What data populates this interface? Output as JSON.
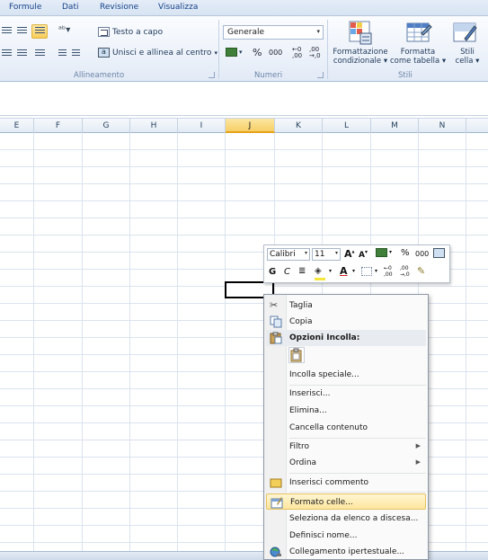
{
  "tabs": [
    "Formule",
    "Dati",
    "Revisione",
    "Visualizza"
  ],
  "ribbon": {
    "alignment": {
      "wrap_text": "Testo a capo",
      "merge_center": "Unisci e allinea al centro",
      "group_label": "Allineamento"
    },
    "number": {
      "format_value": "Generale",
      "percent": "%",
      "thousands": "000",
      "group_label": "Numeri"
    },
    "styles": {
      "conditional_1": "Formattazione",
      "conditional_2": "condizionale",
      "table_1": "Formatta",
      "table_2": "come tabella",
      "cell_1": "Stili",
      "cell_2": "cella",
      "group_label": "Stili"
    }
  },
  "columns": [
    "E",
    "F",
    "G",
    "H",
    "I",
    "J",
    "K",
    "L",
    "M",
    "N"
  ],
  "selected_column": "J",
  "mini_toolbar": {
    "font": "Calibri",
    "size": "11",
    "bold": "G",
    "italic": "C",
    "percent": "%",
    "thousands": "000"
  },
  "context_menu": {
    "cut": "Taglia",
    "copy": "Copia",
    "paste_options": "Opzioni Incolla:",
    "paste_special": "Incolla speciale...",
    "insert": "Inserisci...",
    "delete": "Elimina...",
    "clear_contents": "Cancella contenuto",
    "filter": "Filtro",
    "sort": "Ordina",
    "insert_comment": "Inserisci commento",
    "format_cells": "Formato celle...",
    "pick_from_list": "Seleziona da elenco a discesa...",
    "define_name": "Definisci nome...",
    "hyperlink": "Collegamento ipertestuale..."
  },
  "colors": {
    "highlight": "#fde69d",
    "ribbon": "#eef3fa",
    "grid_line": "#dae3ee"
  }
}
